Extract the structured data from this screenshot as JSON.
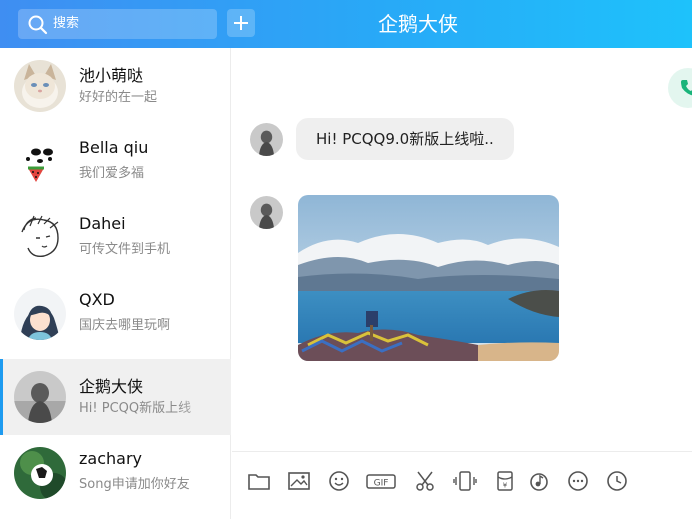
{
  "header": {
    "search_label": "搜索",
    "title": "企鹅大侠",
    "accent_start": "#3f8ef2",
    "accent_end": "#1ec2fb"
  },
  "contacts": [
    {
      "name": "池小萌哒",
      "message": "好好的在一起"
    },
    {
      "name": "Bella qiu",
      "message": "我们爱多福"
    },
    {
      "name": "Dahei",
      "message": "可传文件到手机"
    },
    {
      "name": "QXD",
      "message": "国庆去哪里玩啊"
    },
    {
      "name": "企鹅大侠",
      "message": "Hi! PCQQ新版上线",
      "selected": true
    },
    {
      "name": "zachary",
      "message": "Song申请加你好友"
    }
  ],
  "chat": {
    "message_text": "Hi!  PCQQ9.0新版上线啦..",
    "call_color": "#19b47a"
  },
  "toolbar_icons": [
    "folder-icon",
    "image-icon",
    "emoji-icon",
    "gif-icon",
    "screenshot-icon",
    "shake-icon",
    "red-packet-icon",
    "music-icon",
    "more-icon",
    "history-icon"
  ]
}
